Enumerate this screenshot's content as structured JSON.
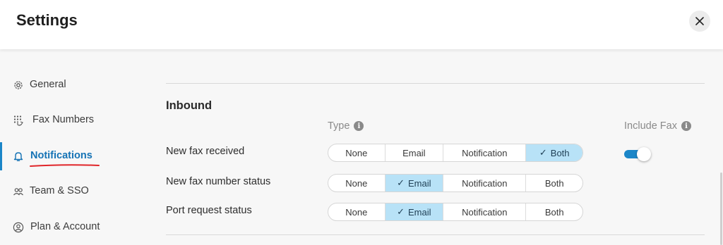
{
  "header": {
    "title": "Settings",
    "close_icon": "close-icon"
  },
  "sidebar": {
    "items": [
      {
        "label": "General",
        "icon": "gear-icon"
      },
      {
        "label": "Fax Numbers",
        "icon": "keypad-icon"
      },
      {
        "label": "Notifications",
        "icon": "bell-icon",
        "active": true
      },
      {
        "label": "Team & SSO",
        "icon": "people-icon"
      },
      {
        "label": "Plan & Account",
        "icon": "account-icon"
      }
    ]
  },
  "main": {
    "section_title": "Inbound",
    "type_header": "Type",
    "include_fax_header": "Include Fax",
    "info_glyph": "i",
    "options": [
      "None",
      "Email",
      "Notification",
      "Both"
    ],
    "rows": [
      {
        "label": "New fax received",
        "selected": "Both",
        "include_fax": true
      },
      {
        "label": "New fax number status",
        "selected": "Email"
      },
      {
        "label": "Port request status",
        "selected": "Email"
      }
    ]
  },
  "colors": {
    "accent": "#1b86c8",
    "selected_bg": "#b8e2f7",
    "active_text": "#1573b5",
    "underline": "#e0262a"
  }
}
